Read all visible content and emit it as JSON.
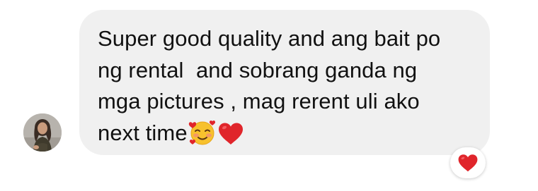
{
  "message": {
    "lines": [
      "Super good quality and ang bait po",
      "ng rental  and sobrang ganda ng",
      "mga pictures , mag rerent uli ako",
      "next time"
    ],
    "inline_icons": [
      "smiling-face-with-hearts-icon",
      "red-heart-icon"
    ]
  },
  "sender": {
    "avatar_icon": "profile-photo-avatar"
  },
  "reaction": {
    "icon": "red-heart-icon"
  },
  "colors": {
    "bubble": "#f0f0f0",
    "text": "#111111",
    "heart": "#e0252b",
    "background": "#ffffff"
  }
}
